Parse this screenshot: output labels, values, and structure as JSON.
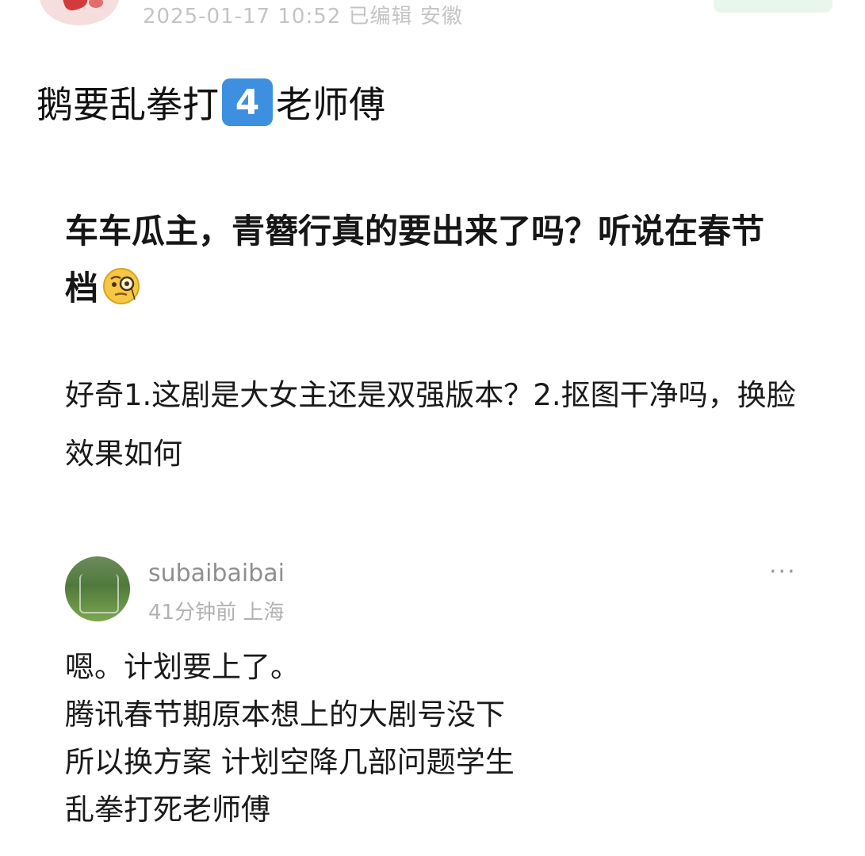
{
  "post": {
    "meta": "2025-01-17 10:52 已编辑 安徽",
    "title_before": "鹅要乱拳打",
    "title_badge": "4",
    "title_after": "老师傅",
    "question": "车车瓜主，青簪行真的要出来了吗？听说在春节档",
    "question_emoji": "face-with-monocle",
    "detail": "好奇1.这剧是大女主还是双强版本？2.抠图干净吗，换脸效果如何"
  },
  "comment": {
    "username": "subaibaibai",
    "meta": "41分钟前 上海",
    "more_label": "···",
    "lines": [
      "嗯。计划要上了。",
      "腾讯春节期原本想上的大剧号没下",
      "所以换方案 计划空降几部问题学生",
      "乱拳打死老师傅"
    ]
  },
  "colors": {
    "badge": "#3d8fe0",
    "meta_text": "#b2b2b2",
    "follow_button": "#e9f6ec"
  }
}
